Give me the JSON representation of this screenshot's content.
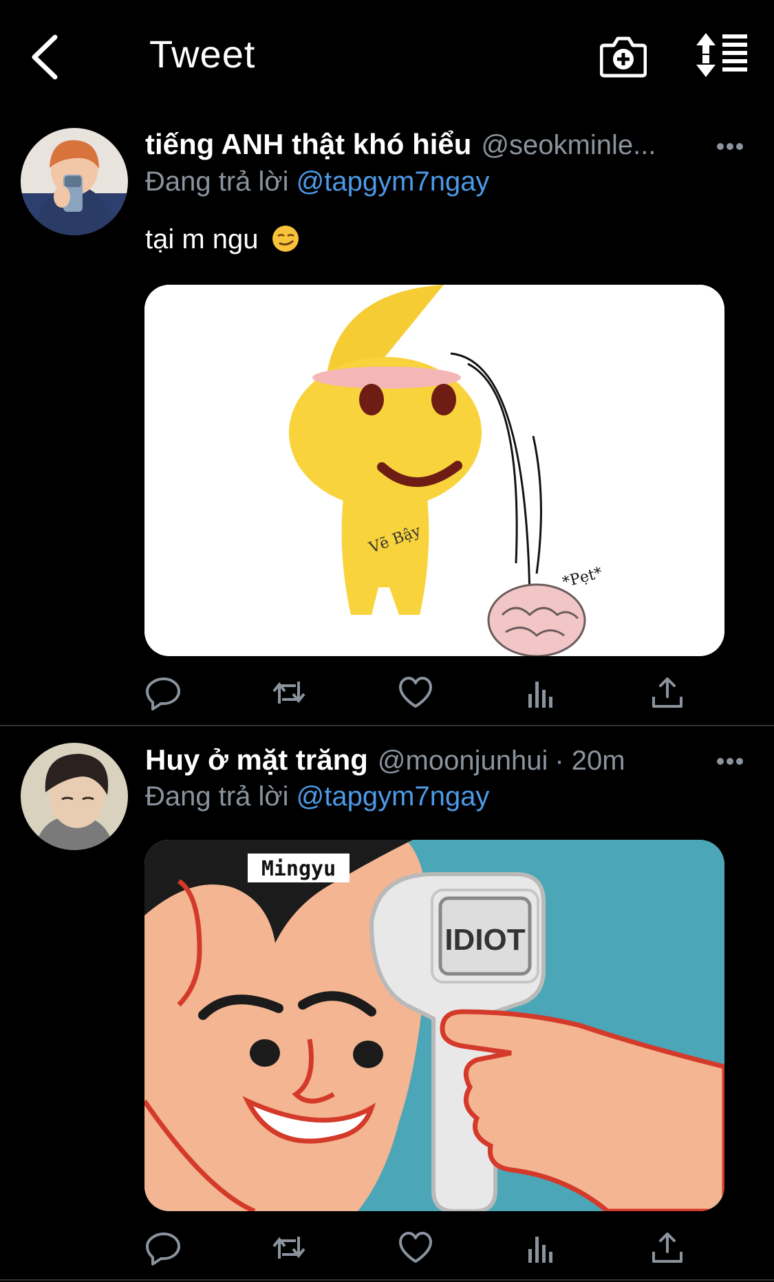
{
  "header": {
    "title": "Tweet",
    "icons": [
      "back-arrow-icon",
      "camera-plus-icon",
      "sort-icon"
    ]
  },
  "tweets": [
    {
      "display_name": "tiếng ANH thật khó hiểu",
      "handle": "@seokminle...",
      "time": "",
      "reply_prefix": "Đang trả lời",
      "reply_to": "@tapgym7ngay",
      "text": "tại m ngu",
      "emoji": "smirking-face",
      "media": {
        "description_icon": "yellow-character-brain-falling",
        "caption": "*Pẹt*",
        "signature": "Vẽ Bậy"
      }
    },
    {
      "display_name": "Huy ở mặt trăng",
      "handle": "@moonjunhui",
      "time": "· 20m",
      "reply_prefix": "Đang trả lời",
      "reply_to": "@tapgym7ngay",
      "text": "",
      "media": {
        "label_top": "Mingyu",
        "label_device": "IDIOT"
      }
    }
  ],
  "colors": {
    "background": "#000000",
    "accent": "#4c9ae8",
    "muted": "#8b949e",
    "divider": "#2f3336"
  }
}
